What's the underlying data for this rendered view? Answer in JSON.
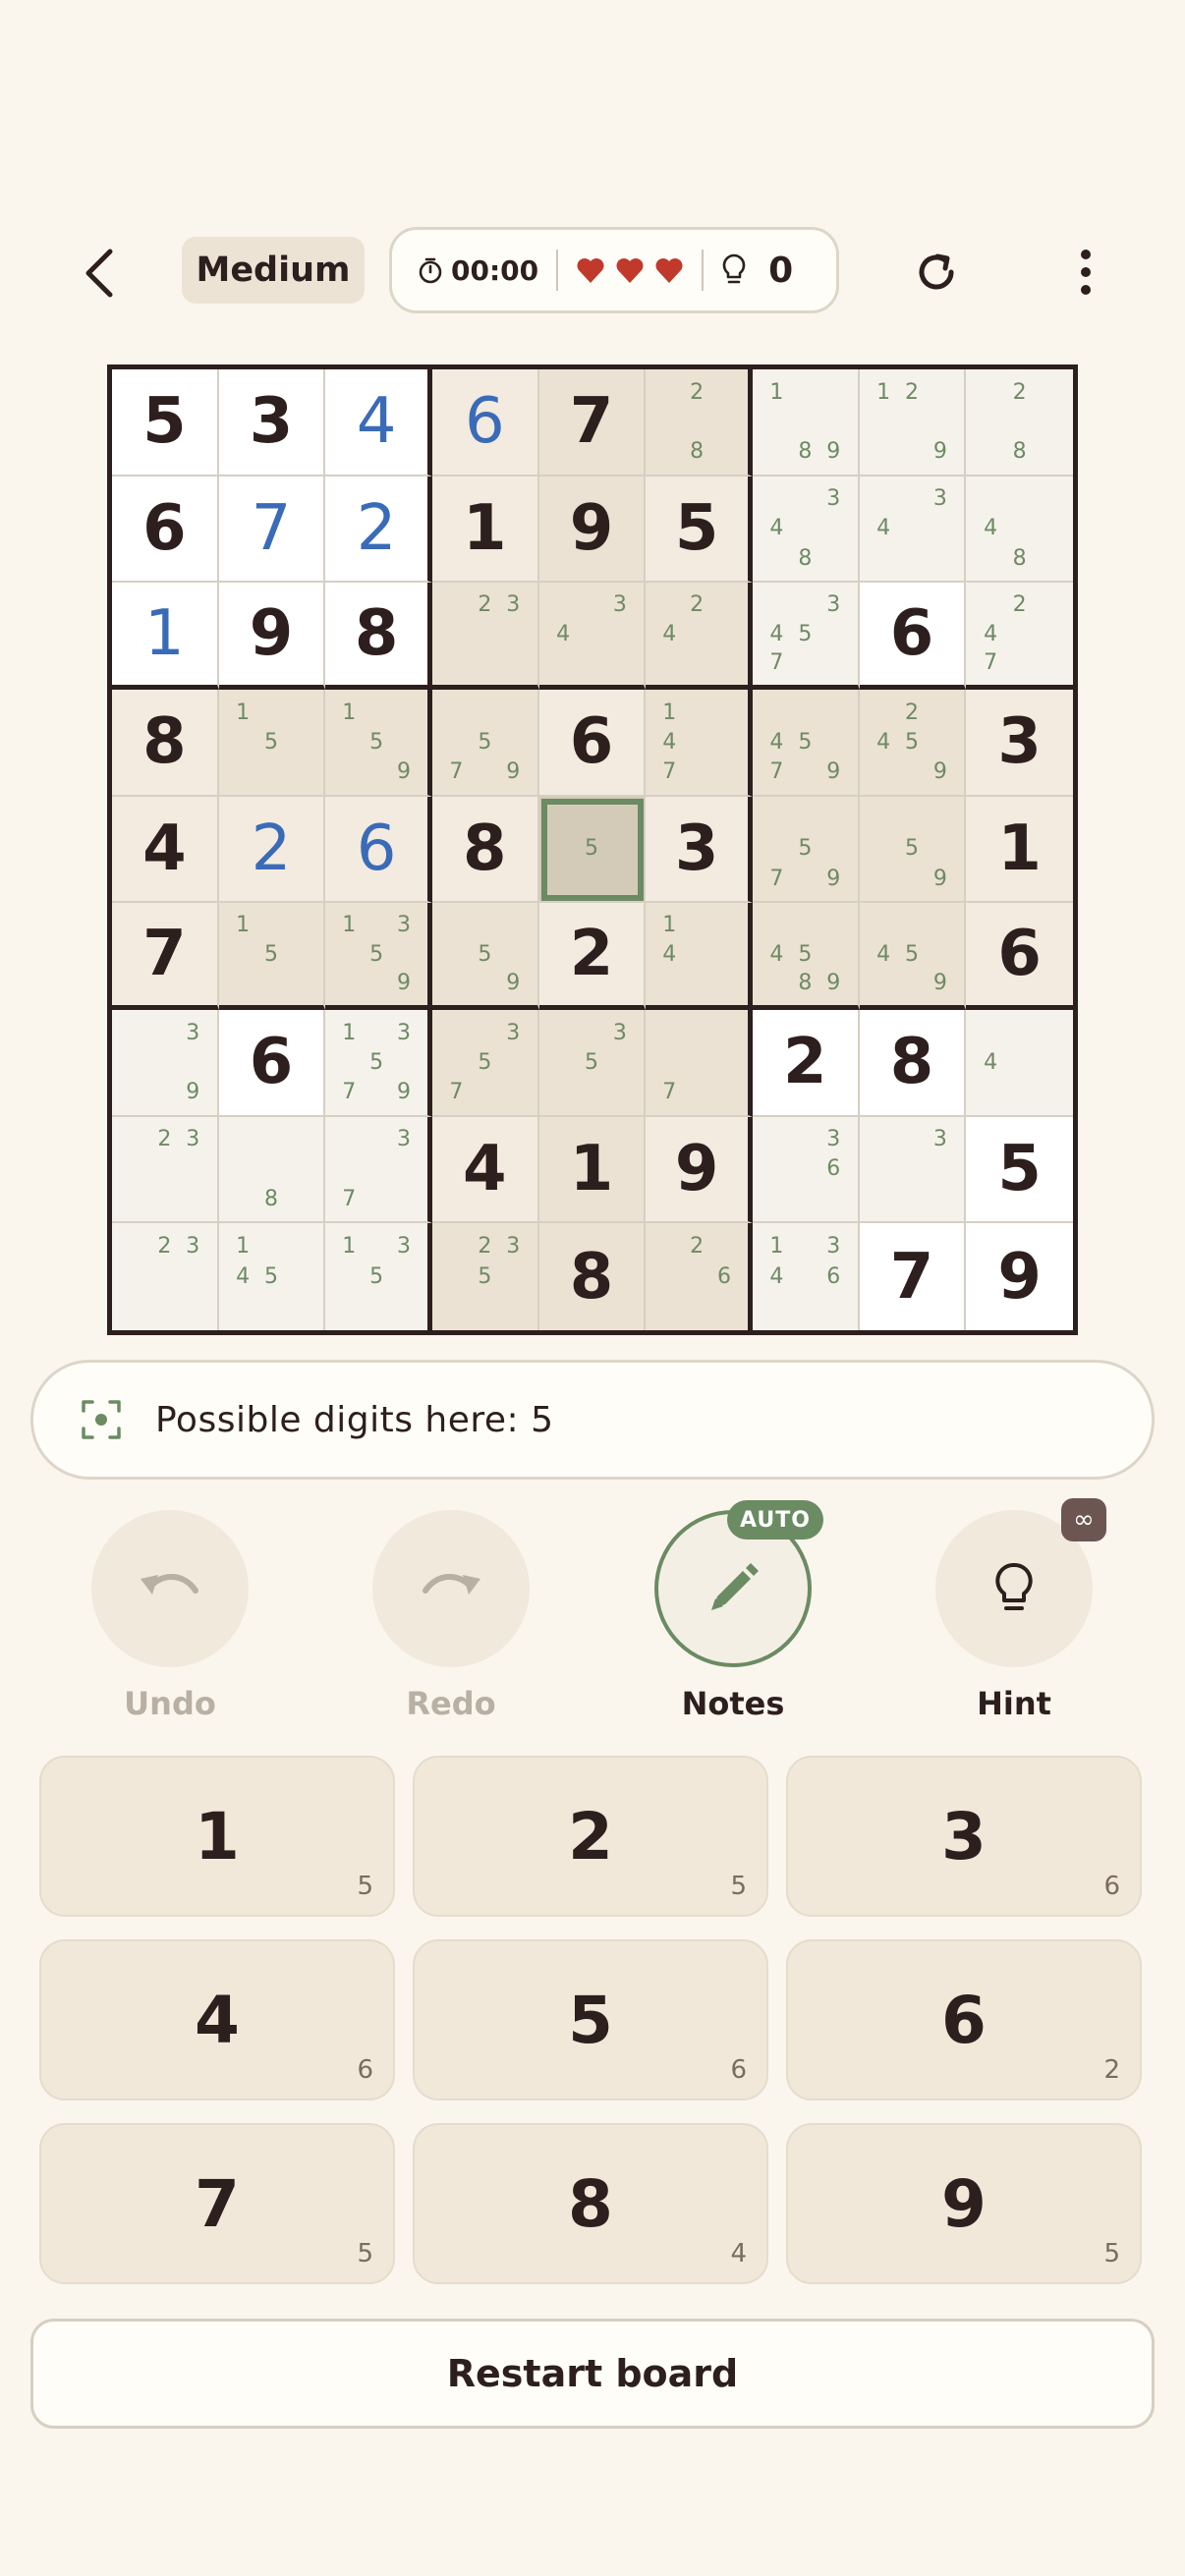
{
  "header": {
    "difficulty": "Medium",
    "timer": "00:00",
    "lives": 3,
    "hints_used": "0"
  },
  "colors": {
    "background": "#faf6ee",
    "given_digit": "#2d1f1d",
    "user_digit": "#3a6bb8",
    "note_digit": "#6f8a64",
    "selection": "#6b8b62",
    "heart": "#c0392b",
    "cell_white": "#ffffff",
    "cell_light": "#f5f2ec",
    "cell_beige": "#f3ebdf",
    "cell_tan": "#ebe2d3",
    "cell_selected": "#d3cbb8"
  },
  "board": {
    "selected": [
      4,
      4
    ],
    "cells": [
      [
        {
          "v": "5",
          "t": "given",
          "bg": "white"
        },
        {
          "v": "3",
          "t": "given",
          "bg": "white"
        },
        {
          "v": "4",
          "t": "user",
          "bg": "white"
        },
        {
          "v": "6",
          "t": "user",
          "bg": "beige"
        },
        {
          "v": "7",
          "t": "given",
          "bg": "tan"
        },
        {
          "n": [
            2,
            8
          ],
          "bg": "tan"
        },
        {
          "n": [
            1,
            8,
            9
          ],
          "bg": "light"
        },
        {
          "n": [
            1,
            2,
            9
          ],
          "bg": "light"
        },
        {
          "n": [
            2,
            8
          ],
          "bg": "light"
        }
      ],
      [
        {
          "v": "6",
          "t": "given",
          "bg": "white"
        },
        {
          "v": "7",
          "t": "user",
          "bg": "white"
        },
        {
          "v": "2",
          "t": "user",
          "bg": "white"
        },
        {
          "v": "1",
          "t": "given",
          "bg": "beige"
        },
        {
          "v": "9",
          "t": "given",
          "bg": "tan"
        },
        {
          "v": "5",
          "t": "given",
          "bg": "beige"
        },
        {
          "n": [
            3,
            4,
            8
          ],
          "bg": "light"
        },
        {
          "n": [
            3,
            4
          ],
          "bg": "light"
        },
        {
          "n": [
            4,
            8
          ],
          "bg": "light"
        }
      ],
      [
        {
          "v": "1",
          "t": "user",
          "bg": "white"
        },
        {
          "v": "9",
          "t": "given",
          "bg": "white"
        },
        {
          "v": "8",
          "t": "given",
          "bg": "white"
        },
        {
          "n": [
            2,
            3
          ],
          "bg": "tan"
        },
        {
          "n": [
            3,
            4
          ],
          "bg": "tan"
        },
        {
          "n": [
            2,
            4
          ],
          "bg": "tan"
        },
        {
          "n": [
            3,
            4,
            5,
            7
          ],
          "bg": "light"
        },
        {
          "v": "6",
          "t": "given",
          "bg": "white"
        },
        {
          "n": [
            2,
            4,
            7
          ],
          "bg": "light"
        }
      ],
      [
        {
          "v": "8",
          "t": "given",
          "bg": "beige"
        },
        {
          "n": [
            1,
            5
          ],
          "bg": "tan"
        },
        {
          "n": [
            1,
            5,
            9
          ],
          "bg": "tan"
        },
        {
          "n": [
            5,
            7,
            9
          ],
          "bg": "tan"
        },
        {
          "v": "6",
          "t": "given",
          "bg": "beige"
        },
        {
          "n": [
            1,
            4,
            7
          ],
          "bg": "tan"
        },
        {
          "n": [
            4,
            5,
            7,
            9
          ],
          "bg": "tan"
        },
        {
          "n": [
            2,
            4,
            5,
            9
          ],
          "bg": "tan"
        },
        {
          "v": "3",
          "t": "given",
          "bg": "beige"
        }
      ],
      [
        {
          "v": "4",
          "t": "given",
          "bg": "beige"
        },
        {
          "v": "2",
          "t": "user",
          "bg": "beige"
        },
        {
          "v": "6",
          "t": "user",
          "bg": "beige"
        },
        {
          "v": "8",
          "t": "given",
          "bg": "beige"
        },
        {
          "n": [
            5
          ],
          "bg": "selected"
        },
        {
          "v": "3",
          "t": "given",
          "bg": "beige"
        },
        {
          "n": [
            5,
            7,
            9
          ],
          "bg": "tan"
        },
        {
          "n": [
            5,
            9
          ],
          "bg": "tan"
        },
        {
          "v": "1",
          "t": "given",
          "bg": "beige"
        }
      ],
      [
        {
          "v": "7",
          "t": "given",
          "bg": "beige"
        },
        {
          "n": [
            1,
            5
          ],
          "bg": "tan"
        },
        {
          "n": [
            1,
            3,
            5,
            9
          ],
          "bg": "tan"
        },
        {
          "n": [
            5,
            9
          ],
          "bg": "tan"
        },
        {
          "v": "2",
          "t": "given",
          "bg": "beige"
        },
        {
          "n": [
            1,
            4
          ],
          "bg": "tan"
        },
        {
          "n": [
            4,
            5,
            8,
            9
          ],
          "bg": "tan"
        },
        {
          "n": [
            4,
            5,
            9
          ],
          "bg": "tan"
        },
        {
          "v": "6",
          "t": "given",
          "bg": "beige"
        }
      ],
      [
        {
          "n": [
            3,
            9
          ],
          "bg": "light"
        },
        {
          "v": "6",
          "t": "given",
          "bg": "white"
        },
        {
          "n": [
            1,
            3,
            5,
            7,
            9
          ],
          "bg": "light"
        },
        {
          "n": [
            3,
            5,
            7
          ],
          "bg": "tan"
        },
        {
          "n": [
            3,
            5
          ],
          "bg": "tan"
        },
        {
          "n": [
            7
          ],
          "bg": "tan"
        },
        {
          "v": "2",
          "t": "given",
          "bg": "white"
        },
        {
          "v": "8",
          "t": "given",
          "bg": "white"
        },
        {
          "n": [
            4
          ],
          "bg": "light"
        }
      ],
      [
        {
          "n": [
            2,
            3
          ],
          "bg": "light"
        },
        {
          "n": [
            8
          ],
          "bg": "light"
        },
        {
          "n": [
            3,
            7
          ],
          "bg": "light"
        },
        {
          "v": "4",
          "t": "given",
          "bg": "beige"
        },
        {
          "v": "1",
          "t": "given",
          "bg": "tan"
        },
        {
          "v": "9",
          "t": "given",
          "bg": "beige"
        },
        {
          "n": [
            3,
            6
          ],
          "bg": "light"
        },
        {
          "n": [
            3
          ],
          "bg": "light"
        },
        {
          "v": "5",
          "t": "given",
          "bg": "white"
        }
      ],
      [
        {
          "n": [
            2,
            3
          ],
          "bg": "light"
        },
        {
          "n": [
            1,
            4,
            5
          ],
          "bg": "light"
        },
        {
          "n": [
            1,
            3,
            5
          ],
          "bg": "light"
        },
        {
          "n": [
            2,
            3,
            5
          ],
          "bg": "tan"
        },
        {
          "v": "8",
          "t": "given",
          "bg": "tan"
        },
        {
          "n": [
            2,
            6
          ],
          "bg": "tan"
        },
        {
          "n": [
            1,
            3,
            4,
            6
          ],
          "bg": "light"
        },
        {
          "v": "7",
          "t": "given",
          "bg": "white"
        },
        {
          "v": "9",
          "t": "given",
          "bg": "white"
        }
      ]
    ]
  },
  "hint_bar": {
    "text": "Possible digits here: 5",
    "icon": "focus-icon"
  },
  "actions": {
    "undo": "Undo",
    "redo": "Redo",
    "notes": "Notes",
    "hint": "Hint",
    "auto_badge": "AUTO",
    "hint_badge": "∞"
  },
  "keypad": [
    {
      "digit": "1",
      "count": "5"
    },
    {
      "digit": "2",
      "count": "5"
    },
    {
      "digit": "3",
      "count": "6"
    },
    {
      "digit": "4",
      "count": "6"
    },
    {
      "digit": "5",
      "count": "6"
    },
    {
      "digit": "6",
      "count": "2"
    },
    {
      "digit": "7",
      "count": "5"
    },
    {
      "digit": "8",
      "count": "4"
    },
    {
      "digit": "9",
      "count": "5"
    }
  ],
  "restart_label": "Restart board"
}
